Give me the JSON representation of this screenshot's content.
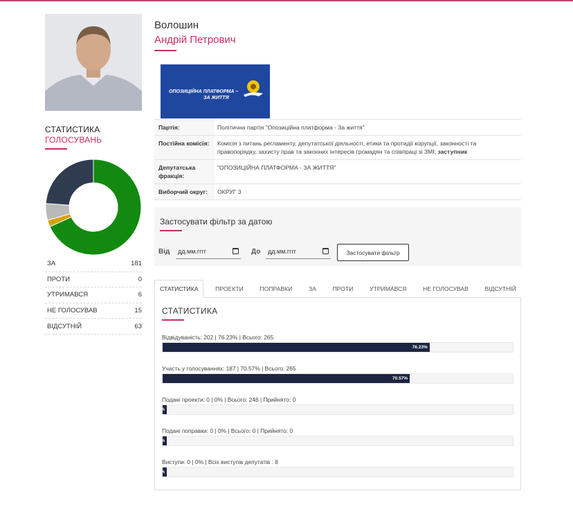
{
  "deputy": {
    "surname": "Волошин",
    "given_names": "Андрій Петрович"
  },
  "party_logo": {
    "text_line1": "ОПОЗИЦІЙНА ПЛАТФОРМА –",
    "text_line2": "ЗА ЖИТТЯ"
  },
  "info": [
    {
      "key": "Партія:",
      "value": "Політична партія \"Опозиційна платформа - За життя\""
    },
    {
      "key": "Постійна комісія:",
      "value": "Комісія з питань регламенту, депутатської діяльності, етики та протидії корупції, законності та правопорядку, захисту прав та законних інтересів громадян та співпраці зі ЗМІ;",
      "value_bold": "заступник"
    },
    {
      "key": "Депутатська фракція:",
      "value": "\"ОПОЗИЦІЙНА ПЛАТФОРМА - ЗА ЖИТТЯ\""
    },
    {
      "key": "Виборчий округ:",
      "value": "ОКРУГ 3"
    }
  ],
  "voting_stats": {
    "title_line1": "СТАТИСТИКА",
    "title_line2": "ГОЛОСУВАНЬ",
    "rows": [
      {
        "label": "ЗА",
        "value": "181"
      },
      {
        "label": "ПРОТИ",
        "value": "0"
      },
      {
        "label": "УТРИМАВСЯ",
        "value": "6"
      },
      {
        "label": "НЕ ГОЛОСУВАВ",
        "value": "15"
      },
      {
        "label": "ВІДСУТНІЙ",
        "value": "63"
      }
    ],
    "donut_colors": {
      "za": "#128a0f",
      "proty": "#c0392b",
      "utrymavsia": "#d4a20c",
      "ne_holosuvav": "#b9b9b9",
      "vidsutnii": "#2f3b4f"
    }
  },
  "filter": {
    "title": "Застосувати фільтр за датою",
    "from_label": "Від",
    "to_label": "До",
    "from_placeholder": "дд.мм.гггг",
    "to_placeholder": "дд.мм.гггг",
    "apply_label": "Застосувати фільтр"
  },
  "tabs": [
    {
      "label": "СТАТИСТИКА",
      "active": true
    },
    {
      "label": "ПРОЕКТИ"
    },
    {
      "label": "ПОПРАВКИ"
    },
    {
      "label": "ЗА"
    },
    {
      "label": "ПРОТИ"
    },
    {
      "label": "УТРИМАВСЯ"
    },
    {
      "label": "НЕ ГОЛОСУВАВ"
    },
    {
      "label": "ВІДСУТНІЙ"
    }
  ],
  "stats_panel": {
    "title": "СТАТИСТИКА",
    "bars": [
      {
        "label": "Відвідуваність: 202 | 76.23% | Всього: 265",
        "percent": 76.23,
        "bar_text": "76.23%"
      },
      {
        "label": "Участь у голосуваннях: 187 | 70.57% | Всього: 265",
        "percent": 70.57,
        "bar_text": "70.57%"
      },
      {
        "label": "Подані проекти: 0 | 0% | Всього: 246 | Прийнято: 0",
        "percent": 0,
        "bar_text": "%"
      },
      {
        "label": "Подані поправки: 0 | 0% | Всього: 0 | Прийнято: 0",
        "percent": 0,
        "bar_text": "%"
      },
      {
        "label": "Виступи: 0 | 0% | Всіх виступів депутатів : 8",
        "percent": 0,
        "bar_text": "%"
      }
    ]
  },
  "colors": {
    "accent": "#c72e5c",
    "bar": "#1c2541",
    "party_blue": "#1f47a0"
  }
}
